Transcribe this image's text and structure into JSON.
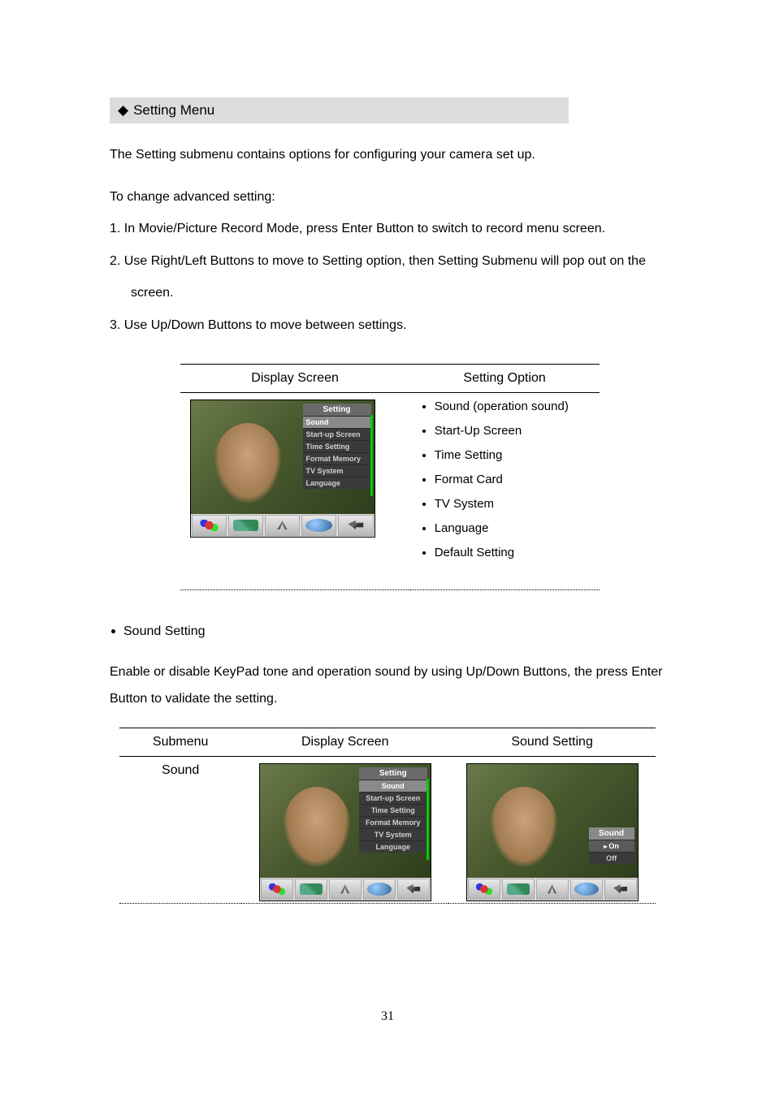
{
  "section": {
    "diamond": "◆",
    "title": "Setting Menu"
  },
  "intro": "The Setting submenu contains options for configuring your camera set up.",
  "steps_intro": "To change advanced setting:",
  "steps": {
    "s1": "1. In Movie/Picture Record Mode, press Enter Button to switch to record menu screen.",
    "s2a": "2. Use Right/Left Buttons to move to Setting option, then Setting Submenu will pop out on the",
    "s2b": "screen.",
    "s3": "3. Use Up/Down Buttons to move between settings."
  },
  "table1": {
    "headers": {
      "c1": "Display Screen",
      "c2": "Setting Option"
    },
    "screenshot": {
      "menu_title": "Setting",
      "items": {
        "i0": "Sound",
        "i1": "Start-up Screen",
        "i2": "Time Setting",
        "i3": "Format Memory",
        "i4": "TV System",
        "i5": "Language"
      }
    },
    "options": {
      "o0": "Sound (operation sound)",
      "o1": "Start-Up Screen",
      "o2": "Time Setting",
      "o3": "Format Card",
      "o4": "TV System",
      "o5": "Language",
      "o6": "Default Setting"
    }
  },
  "sound": {
    "heading": "Sound Setting",
    "desc": "Enable or disable KeyPad tone and operation sound by using Up/Down Buttons, the press Enter Button to validate the setting."
  },
  "table2": {
    "headers": {
      "c1": "Submenu",
      "c2": "Display Screen",
      "c3": "Sound Setting"
    },
    "submenu": "Sound",
    "shot_left": {
      "menu_title": "Setting",
      "items": {
        "i0": "Sound",
        "i1": "Start-up Screen",
        "i2": "Time Setting",
        "i3": "Format Memory",
        "i4": "TV System",
        "i5": "Language"
      }
    },
    "shot_right": {
      "popup_title": "Sound",
      "items": {
        "i0": "On",
        "i1": "Off"
      },
      "caret": "▸"
    }
  },
  "page_number": "31"
}
